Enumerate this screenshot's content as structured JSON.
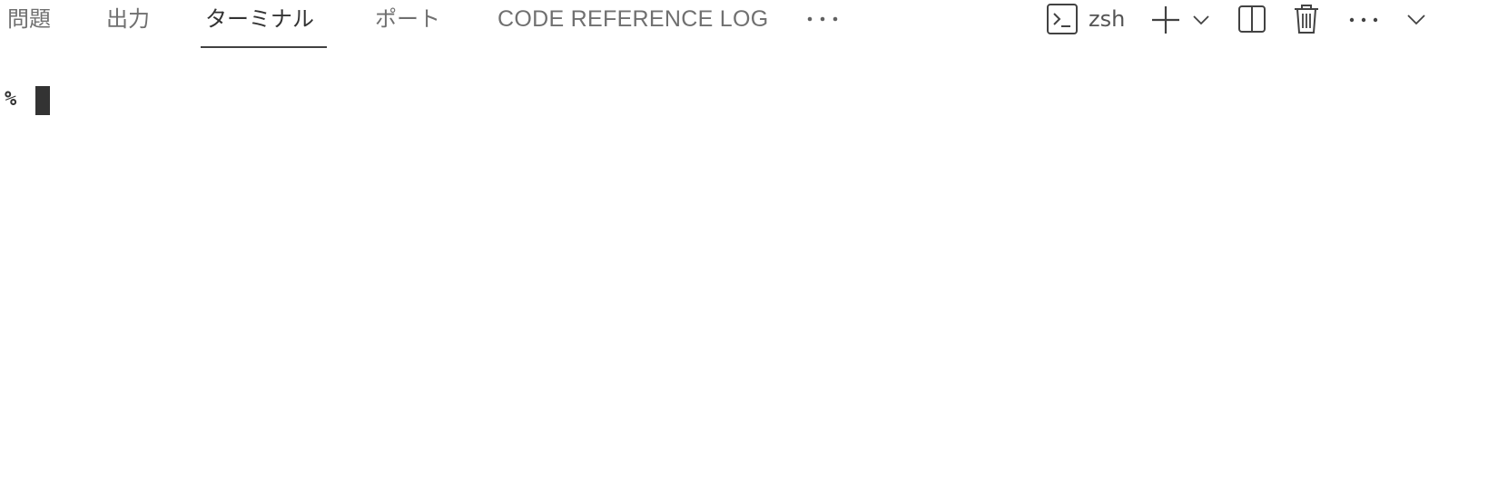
{
  "tabs": {
    "problems": "問題",
    "output": "出力",
    "terminal": "ターミナル",
    "ports": "ポート",
    "code_reference_log": "CODE REFERENCE LOG",
    "active": "terminal"
  },
  "toolbar": {
    "shell_name": "zsh",
    "icons": {
      "more_tabs": "ellipsis-icon",
      "shell": "terminal-icon",
      "new_terminal": "plus-icon",
      "launch_profile": "chevron-down-icon",
      "split": "split-icon",
      "kill": "trash-icon",
      "more_actions": "ellipsis-icon",
      "collapse": "chevron-down-icon"
    }
  },
  "terminal": {
    "prompt": "%"
  },
  "colors": {
    "background": "#ffffff",
    "active_underline": "#424242",
    "text": "#616161"
  }
}
